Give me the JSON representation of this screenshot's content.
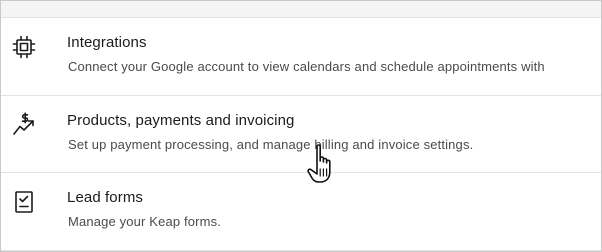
{
  "settings": {
    "items": [
      {
        "icon": "chip-icon",
        "title": "Integrations",
        "description": "Connect your Google account to view calendars and schedule appointments with"
      },
      {
        "icon": "trend-dollar-icon",
        "title": "Products, payments and invoicing",
        "description": "Set up payment processing, and manage billing and invoice settings."
      },
      {
        "icon": "checklist-icon",
        "title": "Lead forms",
        "description": "Manage your Keap forms."
      }
    ]
  },
  "cursor": {
    "icon": "hand-pointer-icon"
  },
  "colors": {
    "title": "#1b1b1f",
    "description": "#4a4a50",
    "divider": "#e3e3e6",
    "background": "#ffffff"
  }
}
